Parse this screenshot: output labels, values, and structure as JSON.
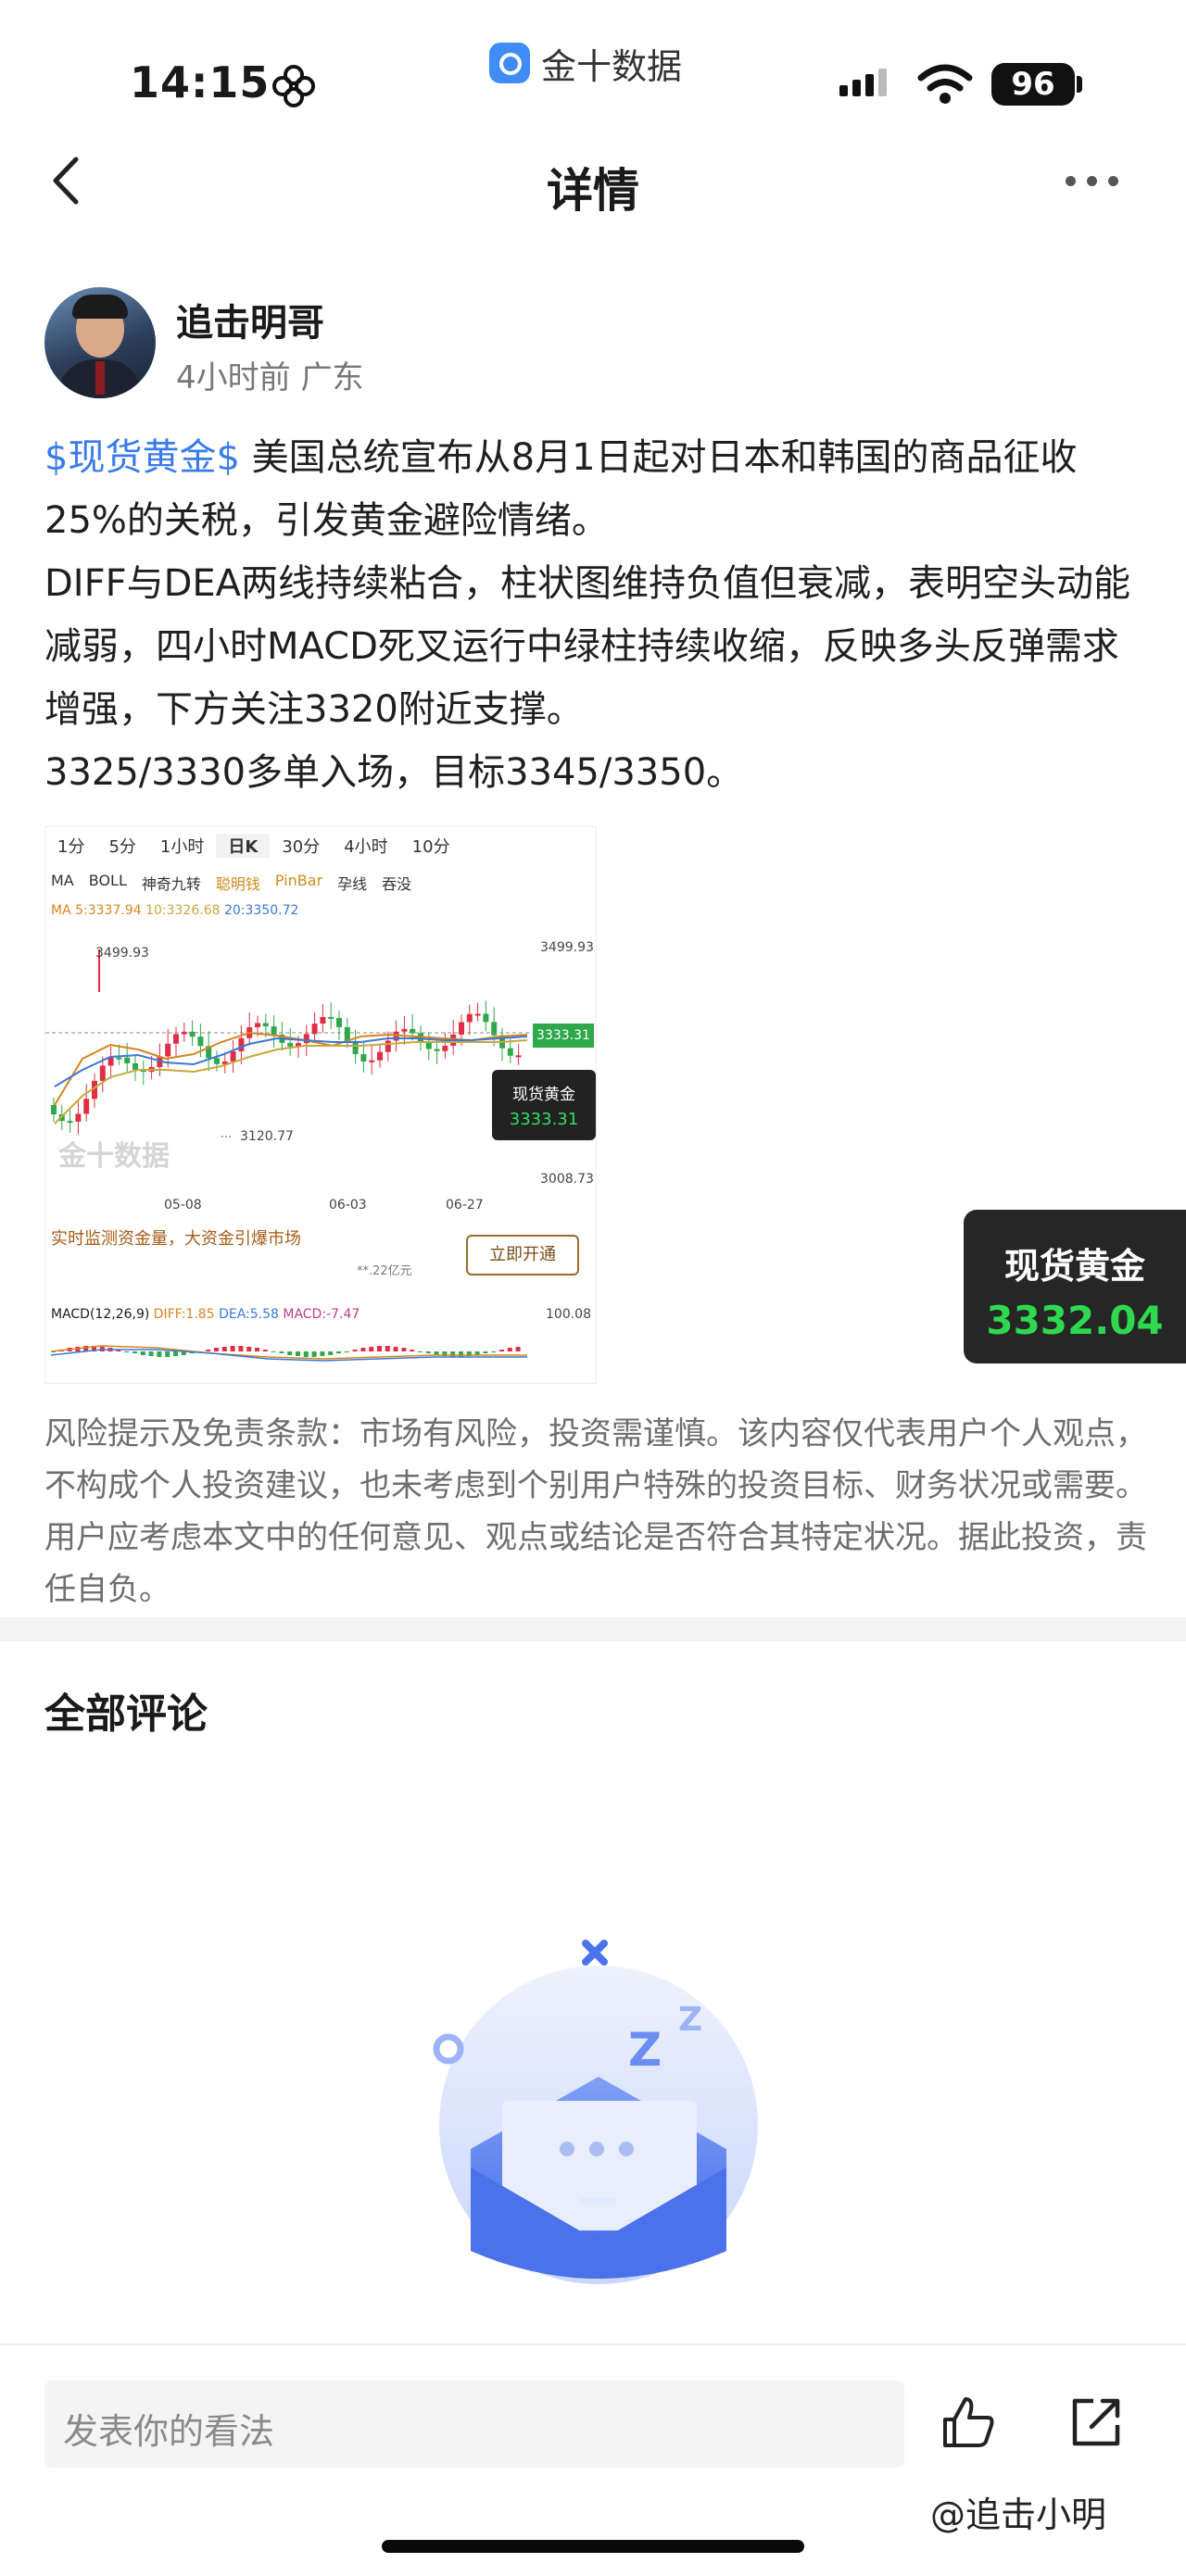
{
  "status_bar": {
    "time": "14:15",
    "app_name": "金十数据",
    "battery": "96"
  },
  "nav": {
    "title": "详情",
    "back_icon": "chevron-left-icon",
    "more_icon": "more-dots-icon"
  },
  "author": {
    "name": "追击明哥",
    "meta": "4小时前 广东"
  },
  "post": {
    "tag": "$现货黄金$",
    "line1_rest": " 美国总统宣布从8月1日起对日本和韩国的商品征收25%的关税，引发黄金避险情绪。",
    "line2": "DIFF与DEA两线持续粘合，柱状图维持负值但衰减，表明空头动能减弱，四小时MACD死叉运行中绿柱持续收缩，反映多头反弹需求增强，下方关注3320附近支撑。",
    "line3": "3325/3330多单入场，目标3345/3350。"
  },
  "chart_image": {
    "tabs": [
      "1分",
      "5分",
      "1小时",
      "日K",
      "30分",
      "4小时",
      "10分"
    ],
    "active_tab": "日K",
    "indicators": [
      "MA",
      "BOLL",
      "神奇九转",
      "聪明钱",
      "PinBar",
      "孕线",
      "吞没"
    ],
    "ma_a": "MA 5:3337.94",
    "ma_b": "10:3326.68",
    "ma_c": "20:3350.72",
    "high_label": "3499.93",
    "low_label": "3120.77",
    "axis_top": "3499.93",
    "axis_bottom": "3008.73",
    "last_price": "3333.31",
    "float_name": "现货黄金",
    "float_value": "3333.31",
    "dates": [
      "05-08",
      "06-03",
      "06-27"
    ],
    "watermark": "金十数据",
    "promo_text": "实时监测资金量，大资金引爆市场",
    "promo_sub": "**.22亿元",
    "promo_button": "立即开通",
    "macd_label": "MACD(12,26,9)",
    "macd_diff": "DIFF:1.85",
    "macd_dea": "DEA:5.58",
    "macd_val": "MACD:-7.47",
    "macd_axis": "100.08",
    "colors": {
      "up": "#e02f44",
      "down": "#2ea84a"
    }
  },
  "quote_card": {
    "name": "现货黄金",
    "value": "3332.04",
    "color": "#2fd94f"
  },
  "disclaimer": "风险提示及免责条款：市场有风险，投资需谨慎。该内容仅代表用户个人观点，不构成个人投资建议，也未考虑到个别用户特殊的投资目标、财务状况或需要。用户应考虑本文中的任何意见、观点或结论是否符合其特定状况。据此投资，责任自负。",
  "comments": {
    "title": "全部评论",
    "empty_icon": "empty-mailbox-icon"
  },
  "bottom_bar": {
    "input_placeholder": "发表你的看法",
    "like_icon": "thumbs-up-icon",
    "share_icon": "share-icon"
  },
  "watermark_user": "@追击小明"
}
